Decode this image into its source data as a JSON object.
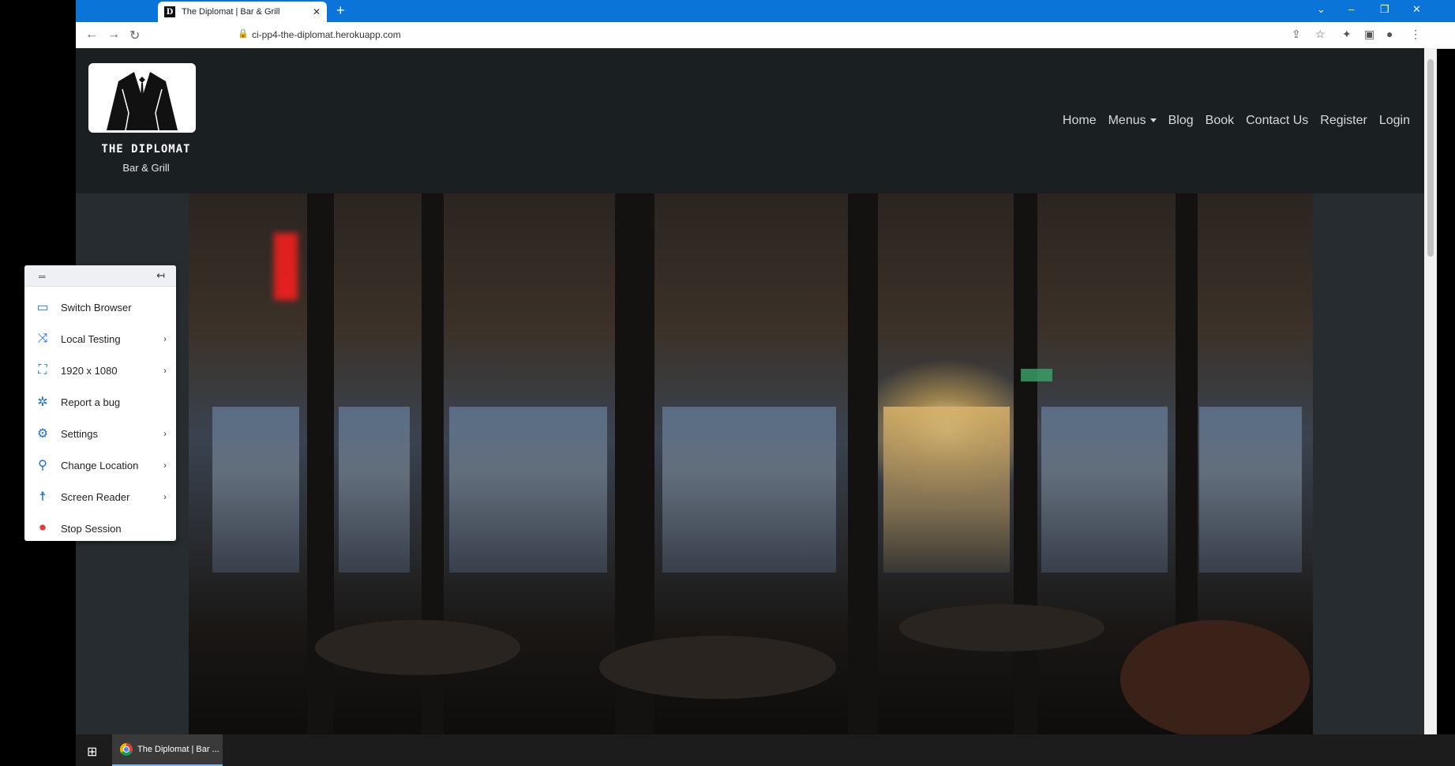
{
  "browser": {
    "tab_title": "The Diplomat | Bar & Grill",
    "tab_favicon": "D",
    "url": "ci-pp4-the-diplomat.herokuapp.com",
    "new_tab": "+",
    "close_tab": "✕",
    "window_controls": [
      "⌄",
      "–",
      "❐",
      "✕"
    ]
  },
  "site": {
    "brand_name": "THE DIPLOMAT",
    "brand_sub": "Bar & Grill",
    "nav": [
      "Home",
      "Menus",
      "Blog",
      "Book",
      "Contact Us",
      "Register",
      "Login"
    ]
  },
  "bs_menu": {
    "items": [
      {
        "label": "Switch Browser",
        "icon": "switch-browser-icon",
        "chevron": false
      },
      {
        "label": "Local Testing",
        "icon": "shuffle-icon",
        "chevron": true
      },
      {
        "label": "1920 x 1080",
        "icon": "resolution-icon",
        "chevron": true
      },
      {
        "label": "Report a bug",
        "icon": "bug-icon",
        "chevron": false
      },
      {
        "label": "Settings",
        "icon": "gear-icon",
        "chevron": true
      },
      {
        "label": "Change Location",
        "icon": "location-pin-icon",
        "chevron": true
      },
      {
        "label": "Screen Reader",
        "icon": "accessibility-icon",
        "chevron": true
      },
      {
        "label": "Stop Session",
        "icon": "stop-icon",
        "chevron": false
      }
    ],
    "chevron": "›"
  },
  "taskbar": {
    "chrome_label": "The Diplomat | Bar ..."
  },
  "colors": {
    "chrome_blue": "#0b74d8",
    "bs_blue": "#1b6fd8",
    "stop_red": "#e53935"
  }
}
